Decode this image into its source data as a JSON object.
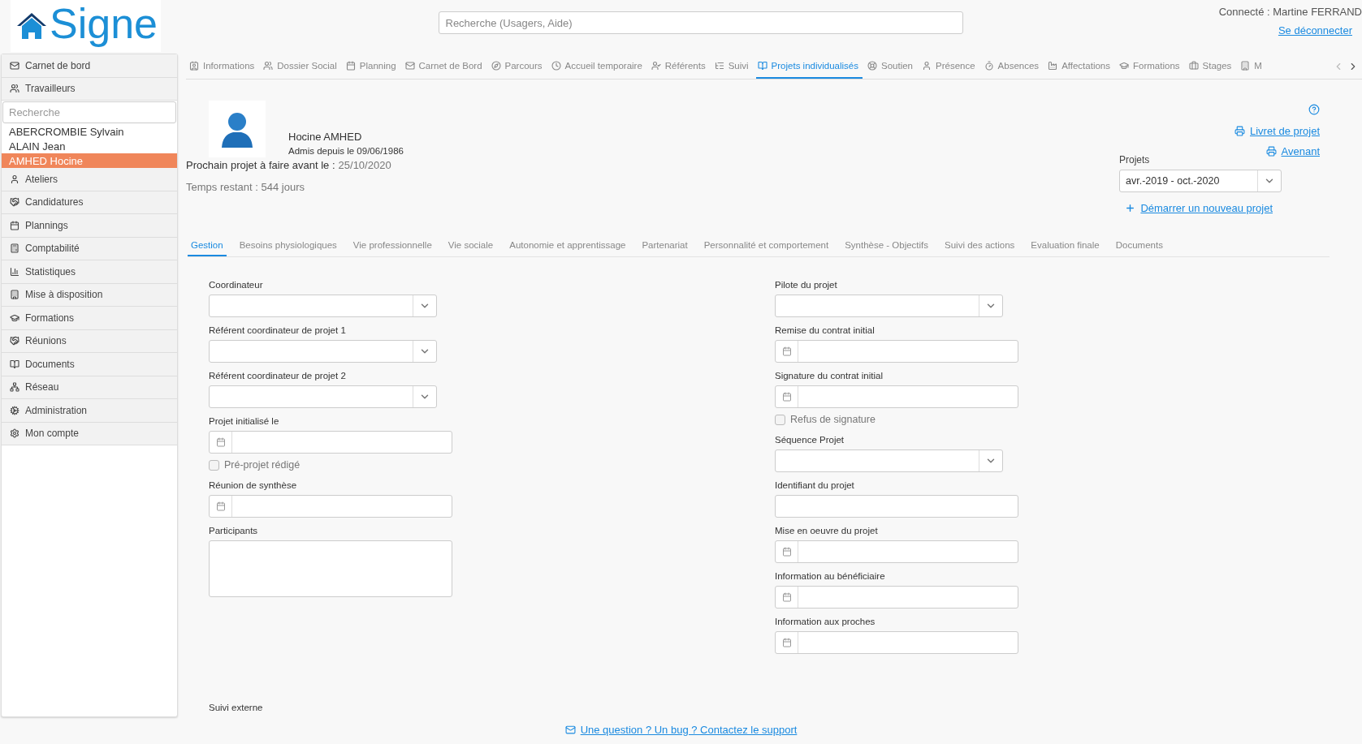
{
  "logo": {
    "text": "Signe"
  },
  "search": {
    "placeholder": "Recherche (Usagers, Aide)"
  },
  "user": {
    "connected": "Connecté : Martine FERRAND",
    "logout": "Se déconnecter"
  },
  "sidebar": {
    "items_top": [
      {
        "label": "Carnet de bord"
      },
      {
        "label": "Travailleurs"
      }
    ],
    "search": {
      "placeholder": "Recherche"
    },
    "workers": [
      {
        "name": "ABERCROMBIE Sylvain",
        "selected": false
      },
      {
        "name": "ALAIN Jean",
        "selected": false
      },
      {
        "name": "AMHED Hocine",
        "selected": true
      }
    ],
    "items": [
      {
        "label": "Ateliers"
      },
      {
        "label": "Candidatures"
      },
      {
        "label": "Plannings"
      },
      {
        "label": "Comptabilité"
      },
      {
        "label": "Statistiques"
      },
      {
        "label": "Mise à disposition"
      },
      {
        "label": "Formations"
      },
      {
        "label": "Réunions"
      },
      {
        "label": "Documents"
      },
      {
        "label": "Réseau"
      },
      {
        "label": "Administration"
      },
      {
        "label": "Mon compte"
      }
    ]
  },
  "tabs": [
    {
      "label": "Informations",
      "selected": false
    },
    {
      "label": "Dossier Social",
      "selected": false
    },
    {
      "label": "Planning",
      "selected": false
    },
    {
      "label": "Carnet de Bord",
      "selected": false
    },
    {
      "label": "Parcours",
      "selected": false
    },
    {
      "label": "Accueil temporaire",
      "selected": false
    },
    {
      "label": "Référents",
      "selected": false
    },
    {
      "label": "Suivi",
      "selected": false
    },
    {
      "label": "Projets individualisés",
      "selected": true
    },
    {
      "label": "Soutien",
      "selected": false
    },
    {
      "label": "Présence",
      "selected": false
    },
    {
      "label": "Absences",
      "selected": false
    },
    {
      "label": "Affectations",
      "selected": false
    },
    {
      "label": "Formations",
      "selected": false
    },
    {
      "label": "Stages",
      "selected": false
    },
    {
      "label": "M",
      "selected": false
    }
  ],
  "profile": {
    "name": "Hocine AMHED",
    "admitted": "Admis depuis le 09/06/1986",
    "next_label": "Prochain projet à faire avant le :",
    "next_date": "25/10/2020",
    "remaining": "Temps restant : 544 jours"
  },
  "actions": {
    "booklet": "Livret de projet",
    "amendment": "Avenant",
    "projects_label": "Projets",
    "projects_value": "avr.-2019 - oct.-2020",
    "new_project": "Démarrer un nouveau projet"
  },
  "subtabs": [
    {
      "label": "Gestion",
      "selected": true
    },
    {
      "label": "Besoins physiologiques",
      "selected": false
    },
    {
      "label": "Vie professionnelle",
      "selected": false
    },
    {
      "label": "Vie sociale",
      "selected": false
    },
    {
      "label": "Autonomie et apprentissage",
      "selected": false
    },
    {
      "label": "Partenariat",
      "selected": false
    },
    {
      "label": "Personnalité et comportement",
      "selected": false
    },
    {
      "label": "Synthèse - Objectifs",
      "selected": false
    },
    {
      "label": "Suivi des actions",
      "selected": false
    },
    {
      "label": "Evaluation finale",
      "selected": false
    },
    {
      "label": "Documents",
      "selected": false
    }
  ],
  "form": {
    "left": [
      {
        "kind": "select",
        "label": "Coordinateur"
      },
      {
        "kind": "select",
        "label": "Référent coordinateur de projet 1"
      },
      {
        "kind": "select",
        "label": "Référent coordinateur de projet 2"
      },
      {
        "kind": "date",
        "label": "Projet initialisé le"
      },
      {
        "kind": "checkbox",
        "label": "Pré-projet rédigé",
        "checked": false
      },
      {
        "kind": "date",
        "label": "Réunion de synthèse"
      },
      {
        "kind": "textarea",
        "label": "Participants"
      }
    ],
    "right": [
      {
        "kind": "select",
        "label": "Pilote du projet"
      },
      {
        "kind": "date",
        "label": "Remise du contrat initial"
      },
      {
        "kind": "date",
        "label": "Signature du contrat initial"
      },
      {
        "kind": "checkbox",
        "label": "Refus de signature",
        "checked": false
      },
      {
        "kind": "select",
        "label": "Séquence Projet"
      },
      {
        "kind": "text",
        "label": "Identifiant du projet"
      },
      {
        "kind": "date",
        "label": "Mise en oeuvre du projet"
      },
      {
        "kind": "date",
        "label": "Information au bénéficiaire"
      },
      {
        "kind": "date",
        "label": "Information aux proches"
      }
    ],
    "external": "Suivi externe"
  },
  "footer": {
    "support": "Une question ? Un bug ? Contactez le support"
  }
}
